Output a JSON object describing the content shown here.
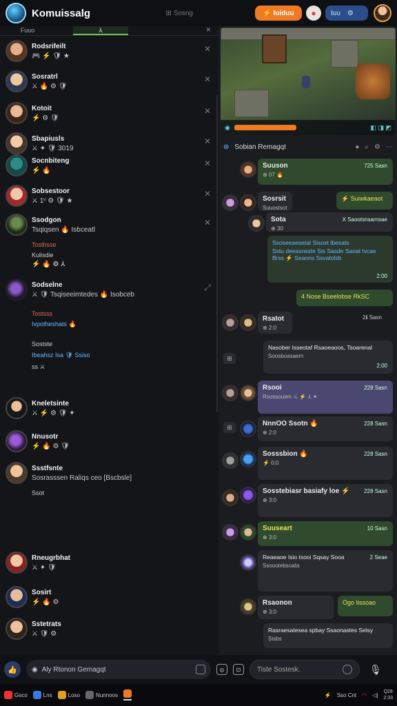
{
  "app": {
    "title": "Komuissalg",
    "search_hint": "⊞ Sosng",
    "primary_btn": "⚡ Iuiduu",
    "pill": "Iuu"
  },
  "left": {
    "tabs": [
      "Fuuo",
      "⅄"
    ],
    "tab_close": "✕",
    "items": [
      {
        "name": "Rodsrifeilt",
        "icons": "🎮 ⚡ 🛡 ★"
      },
      {
        "name": "Sosratrl",
        "icons": "⚔ 🔥 ⚙ 🛡"
      },
      {
        "name": "Kotoit",
        "icons": "⚡ ⚙ 🛡"
      },
      {
        "name": "Sbapiusls",
        "icons": "⚔ ✦ 🛡 3019"
      },
      {
        "name": "Socnbiteng",
        "icons": "⚡ 🔥"
      },
      {
        "name": "Sobsestoor",
        "icons": "⚔ 1ᵛ ⚙ 🛡 ★"
      },
      {
        "name": "Ssodgon",
        "icons": "Tsqiqsen 🔥 Isbceatl"
      },
      {
        "name": "Sodselne",
        "icons": "⚔ 🛡 Tsqiseeimtedes 🔥 Isobceb"
      },
      {
        "name": "Kneletsinte",
        "icons": "⚔ ⚡ ⚙ 🛡 ✦"
      },
      {
        "name": "Nnusotr",
        "icons": "⚡ 🔥 ⚙ 🛡"
      },
      {
        "name": "Ssstfsnte",
        "icons": "Sosrasssen Raliqs ceo [Bscbsle]"
      },
      {
        "name": "Rneugrbhat",
        "icons": "⚔ ✦ 🛡"
      },
      {
        "name": "Sosirt",
        "icons": "⚡ 🔥 ⚙"
      },
      {
        "name": "Sstetrats",
        "icons": "⚔ 🛡 ⚙"
      }
    ],
    "sections": [
      {
        "label": "Tosthsse",
        "sub": "Kulisdie",
        "icons": "⚡ 🔥 ⚙ ⅄"
      },
      {
        "label": "Tostsss",
        "sub": "Ivpotheshats 🔥"
      },
      {
        "label": "Sostste",
        "sub": "Ibeahsz Isa 🛡 Ssiso",
        "extra": "ss ⚔"
      },
      {
        "label": "",
        "sub": "Ssot"
      }
    ]
  },
  "right": {
    "chat_title": "Sobian Remagqt",
    "messages": [
      {
        "name": "Suuson",
        "text": "⊕ 07 🔥",
        "time": "725 Sasn",
        "tone": "g"
      },
      {
        "name": "Sosrsit",
        "text": "Suuostsot",
        "time": "⚡ Suiwkaeaot",
        "tone": "d"
      },
      {
        "name": "Sota",
        "text": "⊕ 30",
        "time": "X Saootsnsarnsae",
        "tone": "d"
      },
      {
        "name": "Ssoseeaesetat Sisost Ibesats",
        "text": "Sstu deeasnsste Sis Sasde Saoat Ivcas Brss ⚡ Seaons Ssvatolsb",
        "time": "2:00",
        "tone": "g"
      },
      {
        "name": "4 Nose Bseelobse RkSC",
        "text": "",
        "time": "",
        "tone": "g"
      },
      {
        "name": "Rsatot",
        "text": "⊕ 2:0",
        "time": "2ℹ Sasn",
        "tone": "d"
      },
      {
        "name": "Nasober Isseotaf Rsaoeaoos, Tsoarenal",
        "text": "Soosboasaem",
        "time": "2:00",
        "tone": "d"
      },
      {
        "name": "Rsooi",
        "text": "Rsossouien ⚔ ⚡ ⅄ ✦",
        "time": "228 Sasn",
        "tone": "p"
      },
      {
        "name": "NnnOO Ssotn 🔥",
        "text": "⊕ 2:0",
        "time": "228 Sasn",
        "tone": "d"
      },
      {
        "name": "Sosssbion 🔥",
        "text": "⚡ 0:0",
        "time": "228 Sasn",
        "tone": "d"
      },
      {
        "name": "Sosstebiasr basiafy loe ⚡",
        "text": "⊕ 3:0",
        "time": "228 Sasn",
        "tone": "d"
      },
      {
        "name": "Suuseart",
        "text": "⊕ 3:0",
        "time": "10 Sasn",
        "tone": "g"
      },
      {
        "name": "Reaeaoe Isio Isooi Sqsay Sooa",
        "text": "Ssoootebsoata",
        "time": "2 Seae",
        "tone": "d"
      },
      {
        "name": "Rsaonon",
        "text": "⊕ 3:0",
        "time": "Ogo Iissoao",
        "tone": "d"
      },
      {
        "name": "Rasraesatesea spbay Ssaonastes Selsy",
        "text": "Sisbs",
        "time": "",
        "tone": "d"
      }
    ]
  },
  "composer": {
    "placeholder": "Aly Rtonon Gemagqt",
    "placeholder2": "Tiste Sostesk.",
    "mic": "🎙"
  },
  "taskbar": {
    "items": [
      "Gsco",
      "Lns",
      "Loso",
      "Nunnoos"
    ],
    "tray": "Sso Cnt",
    "clock": "Q28\n2:33"
  }
}
